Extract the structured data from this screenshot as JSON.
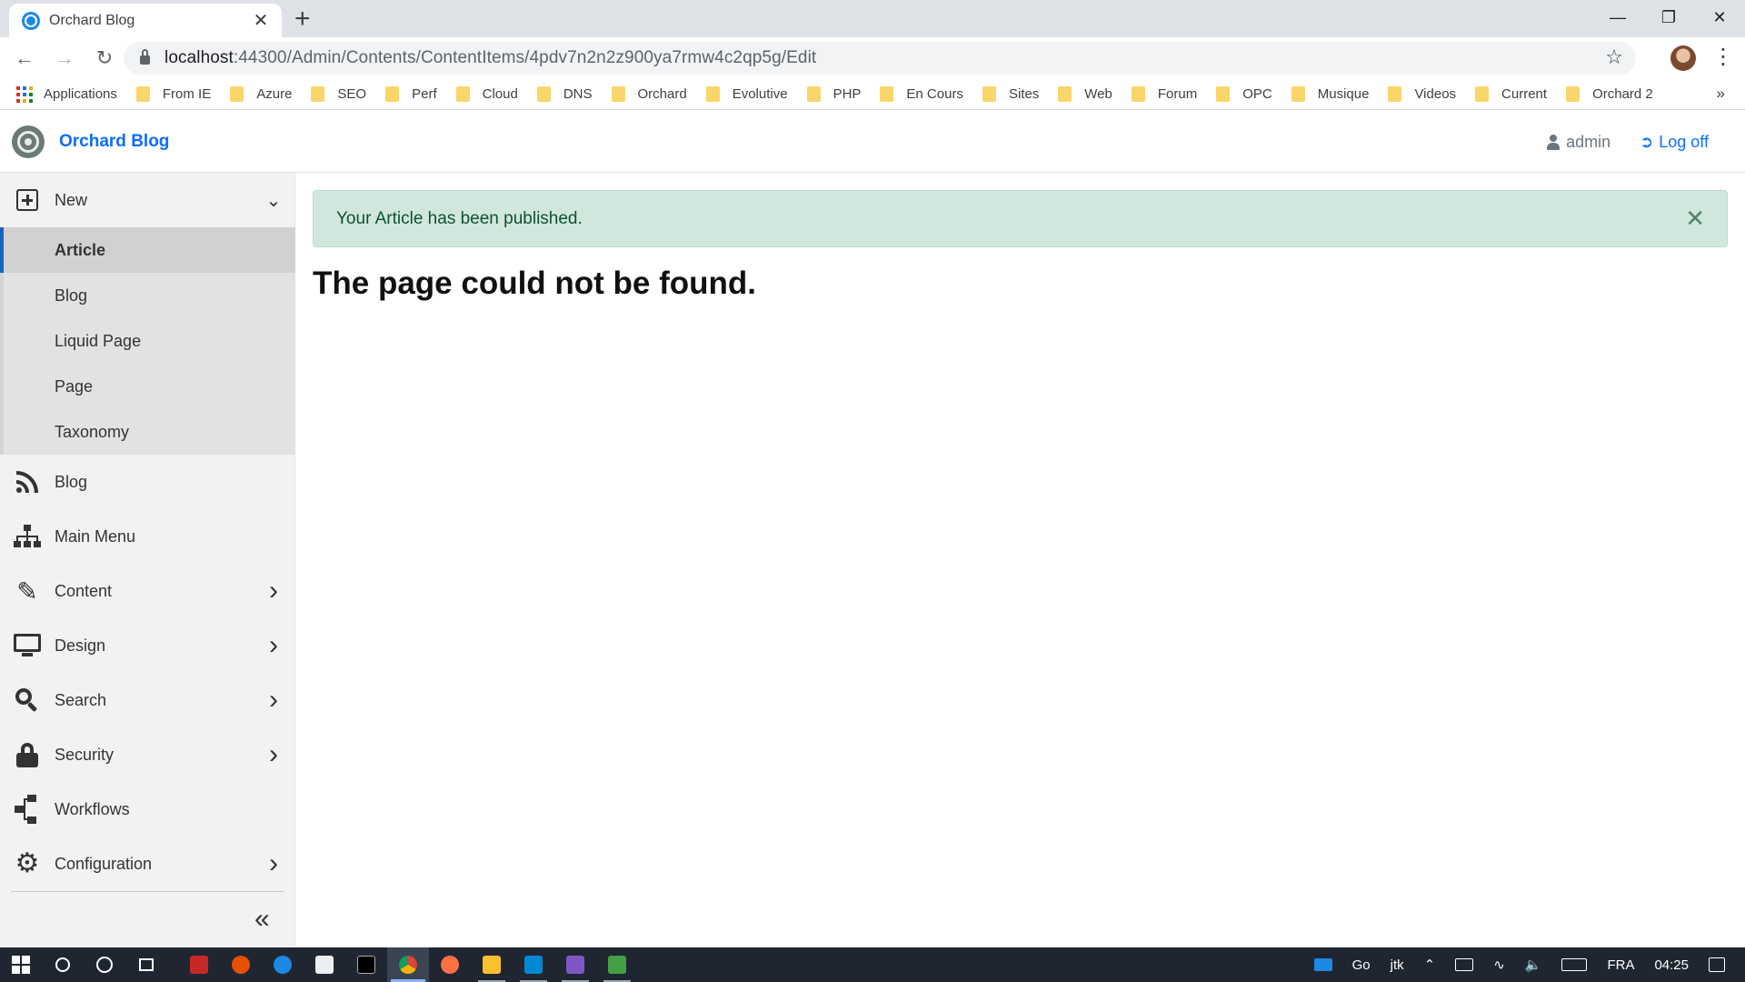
{
  "browser": {
    "tab_title": "Orchard Blog",
    "tab_close": "✕",
    "new_tab": "+",
    "url_host": "localhost",
    "url_path": ":44300/Admin/Contents/ContentItems/4pdv7n2n2z900ya7rmw4c2qp5g/Edit",
    "bookmarks_apps": "Applications",
    "bookmarks": [
      "From IE",
      "Azure",
      "SEO",
      "Perf",
      "Cloud",
      "DNS",
      "Orchard",
      "Evolutive",
      "PHP",
      "En Cours",
      "Sites",
      "Web",
      "Forum",
      "OPC",
      "Musique",
      "Videos",
      "Current",
      "Orchard 2"
    ],
    "bookmarks_more": "»"
  },
  "header": {
    "brand": "Orchard Blog",
    "user": "admin",
    "logoff": "Log off"
  },
  "sidebar": {
    "new_label": "New",
    "new_items": [
      "Article",
      "Blog",
      "Liquid Page",
      "Page",
      "Taxonomy"
    ],
    "active_new_item": "Article",
    "items": [
      {
        "label": "Blog",
        "icon": "rss-icon",
        "has_children": false
      },
      {
        "label": "Main Menu",
        "icon": "sitemap-icon",
        "has_children": false
      },
      {
        "label": "Content",
        "icon": "edit-icon",
        "has_children": true
      },
      {
        "label": "Design",
        "icon": "monitor-icon",
        "has_children": true
      },
      {
        "label": "Search",
        "icon": "search-icon",
        "has_children": true
      },
      {
        "label": "Security",
        "icon": "lock-icon",
        "has_children": true
      },
      {
        "label": "Workflows",
        "icon": "workflow-icon",
        "has_children": false
      },
      {
        "label": "Configuration",
        "icon": "gear-icon",
        "has_children": true
      }
    ],
    "collapse_glyph": "«"
  },
  "main": {
    "alert": "Your Article has been published.",
    "alert_close": "✕",
    "title": "The page could not be found."
  },
  "taskbar": {
    "tray_go": "Go",
    "tray_jtk": "jtk",
    "tray_lang": "FRA",
    "tray_time": "04:25"
  },
  "colors": {
    "accent": "#0d6efd",
    "alert_bg": "#d1e7dd",
    "alert_text": "#0f5132",
    "sidebar_bg": "#f2f2f2",
    "active_marker": "#1565c0",
    "taskbar_bg": "#1f2631"
  }
}
